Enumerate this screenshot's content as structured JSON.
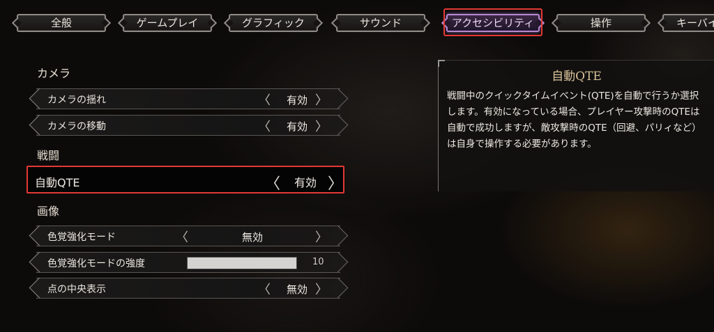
{
  "tabs": [
    {
      "label": "全般"
    },
    {
      "label": "ゲームプレイ"
    },
    {
      "label": "グラフィック"
    },
    {
      "label": "サウンド"
    },
    {
      "label": "アクセシビリティ"
    },
    {
      "label": "操作"
    },
    {
      "label": "キーバイ"
    }
  ],
  "active_tab": "アクセシビリティ",
  "sections": {
    "camera": {
      "title": "カメラ",
      "items": [
        {
          "label": "カメラの揺れ",
          "value": "有効"
        },
        {
          "label": "カメラの移動",
          "value": "有効"
        }
      ]
    },
    "combat": {
      "title": "戦闘",
      "items": [
        {
          "label": "自動QTE",
          "value": "有効"
        }
      ]
    },
    "image": {
      "title": "画像",
      "items": [
        {
          "label": "色覚強化モード",
          "value": "無効"
        },
        {
          "label": "色覚強化モードの強度",
          "value": "10",
          "fill_fraction": 1.0
        },
        {
          "label": "点の中央表示",
          "value": "無効"
        }
      ]
    }
  },
  "description": {
    "title": "自動QTE",
    "body": "戦闘中のクイックタイムイベント(QTE)を自動で行うか選択します。有効になっている場合、プレイヤー攻撃時のQTEは自動で成功しますが、敵攻撃時のQTE（回避、パリィなど）は自身で操作する必要があります。"
  },
  "glyphs": {
    "prev": "〈",
    "next": "〉"
  },
  "colors": {
    "highlight": "#e53935",
    "active_tab": "#b88ad2",
    "desc_title": "#d9c29a"
  }
}
